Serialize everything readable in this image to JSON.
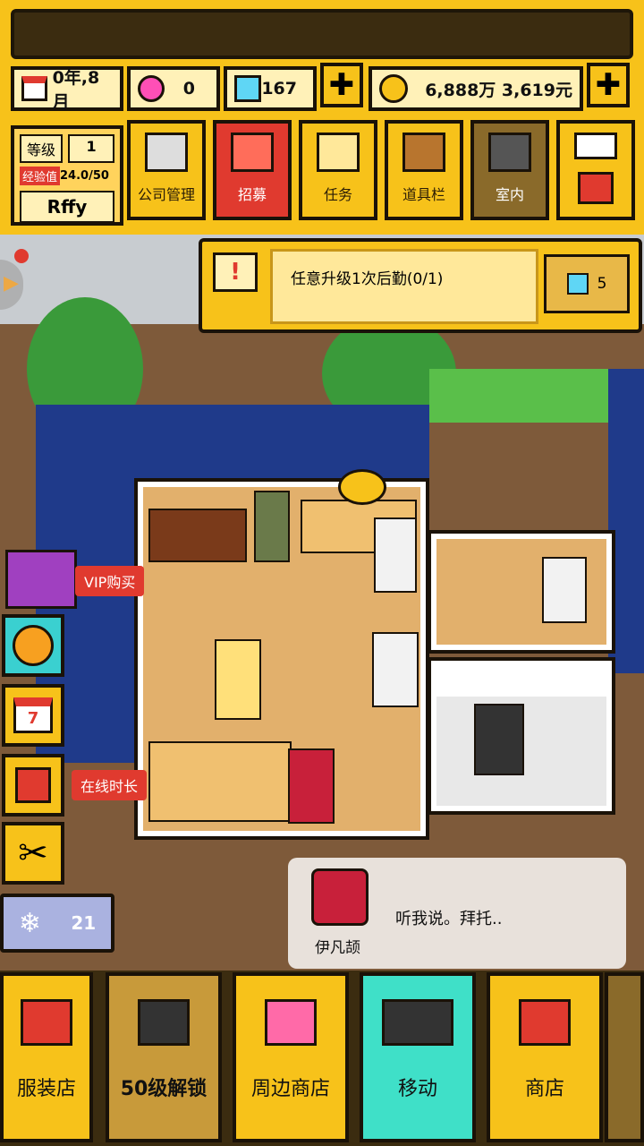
{
  "header": {
    "date": "0年,8月",
    "pink_gems": "0",
    "blue_gems": "167",
    "money": "6,888万 3,619元",
    "plus": "✚"
  },
  "player": {
    "level_label": "等级",
    "level": "1",
    "exp_label": "经验值",
    "exp": "24.0/50",
    "name": "Rffy"
  },
  "menu": [
    "公司管理",
    "招募",
    "任务",
    "道具栏",
    "室内"
  ],
  "quest": {
    "icon": "!",
    "text": "任意升级1次后勤(0/1)",
    "reward": "5"
  },
  "side": {
    "vip": "VIP购买",
    "online": "在线时长",
    "snow_count": "21",
    "calendar_day": "7"
  },
  "dialog": {
    "speaker": "伊凡颉",
    "text": "听我说。拜托.."
  },
  "bottom_nav": [
    "服装店",
    "50级解锁",
    "周边商店",
    "移动",
    "商店"
  ],
  "colors": {
    "accent_yellow": "#f7c21a",
    "recruit_red": "#e03a2f",
    "move_teal": "#3fe0c8"
  }
}
